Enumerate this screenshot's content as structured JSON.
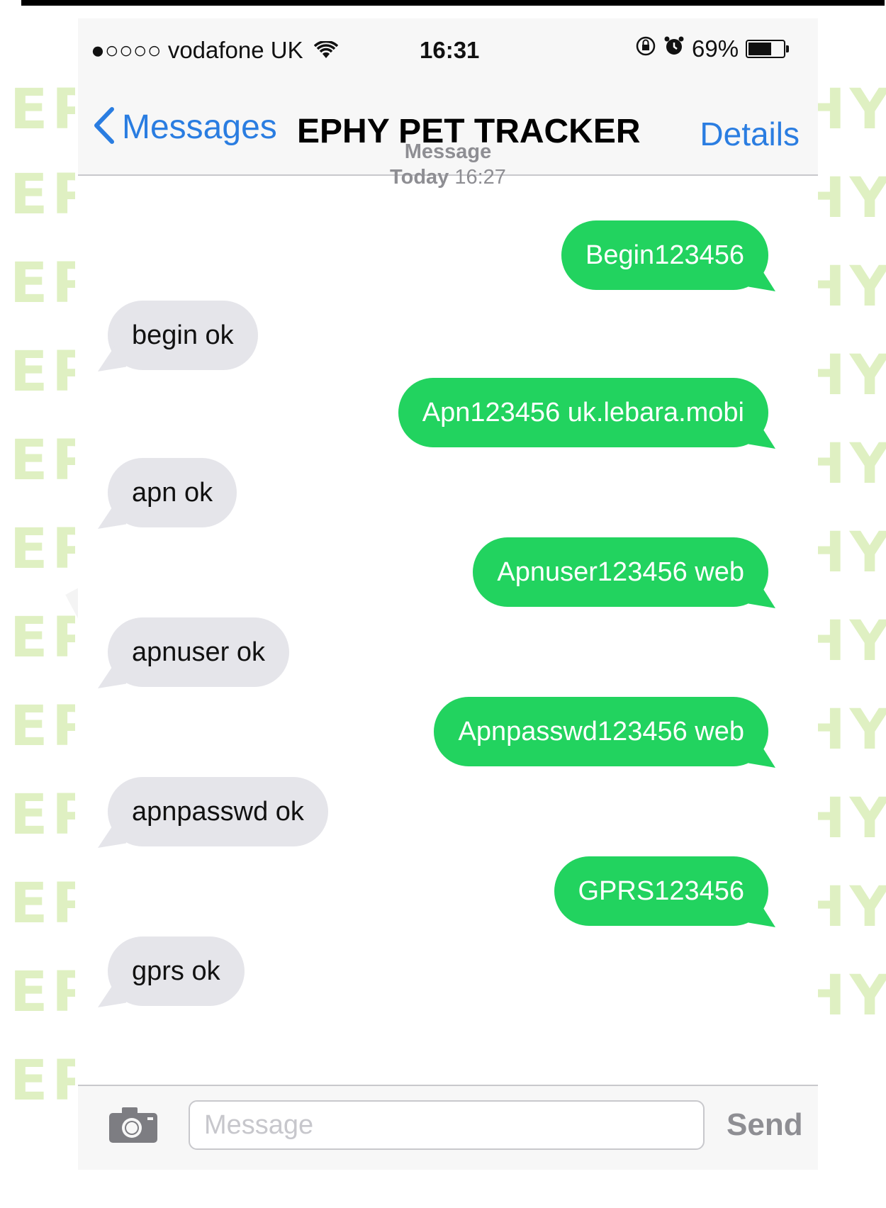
{
  "status_bar": {
    "carrier": "●○○○○ vodafone UK",
    "time": "16:31",
    "battery": "69%",
    "battery_level": 0.69
  },
  "nav": {
    "back_label": "Messages",
    "title": "EPHY PET TRACKER",
    "details_label": "Details"
  },
  "thread": {
    "header_line1": "Message",
    "header_day": "Today",
    "header_time": "16:27"
  },
  "messages": [
    {
      "direction": "outgoing",
      "text": "Begin123456"
    },
    {
      "direction": "incoming",
      "text": "begin ok"
    },
    {
      "direction": "outgoing",
      "text": "Apn123456 uk.lebara.mobi"
    },
    {
      "direction": "incoming",
      "text": "apn ok"
    },
    {
      "direction": "outgoing",
      "text": "Apnuser123456 web"
    },
    {
      "direction": "incoming",
      "text": "apnuser ok"
    },
    {
      "direction": "outgoing",
      "text": "Apnpasswd123456 web"
    },
    {
      "direction": "incoming",
      "text": "apnpasswd ok"
    },
    {
      "direction": "outgoing",
      "text": "GPRS123456"
    },
    {
      "direction": "incoming",
      "text": "gprs ok"
    }
  ],
  "composer": {
    "placeholder": "Message",
    "send_label": "Send"
  },
  "watermark": {
    "text": "EPHY"
  },
  "colors": {
    "outgoing_bubble": "#22d35f",
    "incoming_bubble": "#e5e5ea",
    "link_blue": "#2a7de1",
    "watermark": "#dff0c2"
  },
  "icons": [
    "chevron-left-icon",
    "wifi-icon",
    "rotation-lock-icon",
    "alarm-icon",
    "battery-icon",
    "camera-icon"
  ]
}
